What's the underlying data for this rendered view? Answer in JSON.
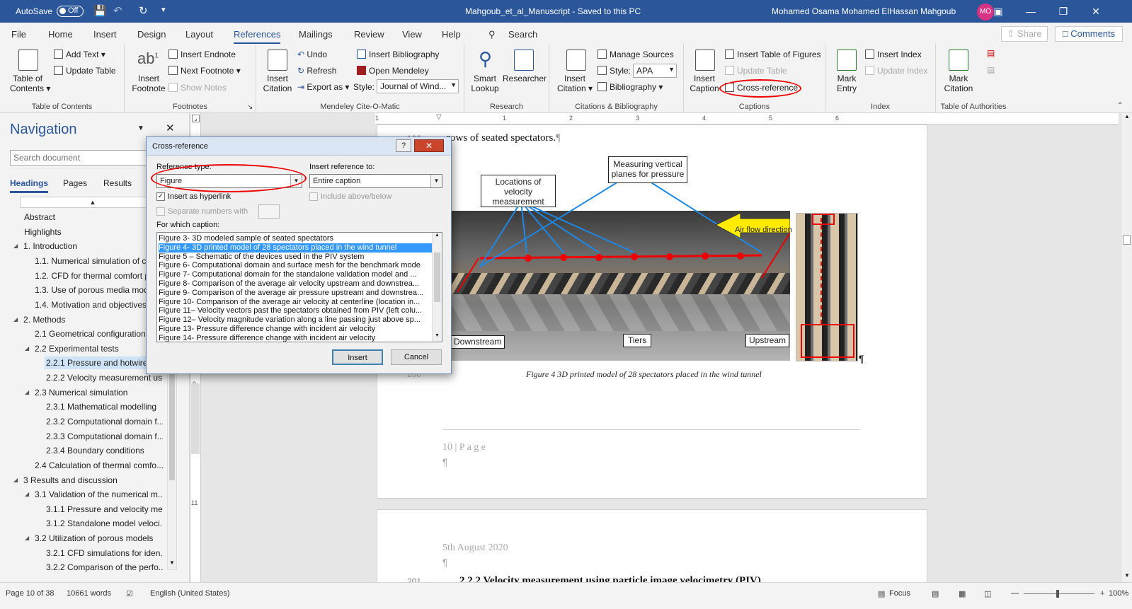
{
  "titlebar": {
    "autosave_label": "AutoSave",
    "autosave_state": "Off",
    "doc_title": "Mahgoub_et_al_Manuscript  -  Saved to this PC",
    "user_name": "Mohamed Osama Mohamed ElHassan Mahgoub",
    "user_initials": "MO"
  },
  "tabs": [
    {
      "label": "File"
    },
    {
      "label": "Home"
    },
    {
      "label": "Insert"
    },
    {
      "label": "Design"
    },
    {
      "label": "Layout"
    },
    {
      "label": "References"
    },
    {
      "label": "Mailings"
    },
    {
      "label": "Review"
    },
    {
      "label": "View"
    },
    {
      "label": "Help"
    }
  ],
  "search_label": "Search",
  "share_label": "Share",
  "comments_label": "Comments",
  "ribbon": {
    "toc": {
      "label": "Table of Contents",
      "btn1": "Table of",
      "btn2": "Contents",
      "add_text": "Add Text",
      "update_table": "Update Table"
    },
    "footnotes": {
      "label": "Footnotes",
      "insert1": "Insert",
      "insert2": "Footnote",
      "insert_endnote": "Insert Endnote",
      "next_footnote": "Next Footnote",
      "show_notes": "Show Notes"
    },
    "mendeley": {
      "label": "Mendeley Cite-O-Matic",
      "insert1": "Insert",
      "insert2": "Citation",
      "undo": "Undo",
      "refresh": "Refresh",
      "export_as": "Export as",
      "insert_bibliography": "Insert Bibliography",
      "open_mendeley": "Open Mendeley",
      "style_label": "Style:",
      "style_value": "Journal of Wind..."
    },
    "research": {
      "label": "Research",
      "smart1": "Smart",
      "smart2": "Lookup",
      "researcher": "Researcher"
    },
    "citations": {
      "label": "Citations & Bibliography",
      "insert1": "Insert",
      "insert2": "Citation",
      "manage_sources": "Manage Sources",
      "style_label": "Style:",
      "style_value": "APA",
      "bibliography": "Bibliography"
    },
    "captions": {
      "label": "Captions",
      "insert1": "Insert",
      "insert2": "Caption",
      "insert_tof": "Insert Table of Figures",
      "update_table": "Update Table",
      "cross_reference": "Cross-reference"
    },
    "index": {
      "label": "Index",
      "mark1": "Mark",
      "mark2": "Entry",
      "insert_index": "Insert Index",
      "update_index": "Update Index"
    },
    "toa": {
      "label": "Table of Authorities",
      "mark1": "Mark",
      "mark2": "Citation"
    }
  },
  "nav": {
    "title": "Navigation",
    "search_placeholder": "Search document",
    "tabs": [
      "Headings",
      "Pages",
      "Results"
    ],
    "items": [
      {
        "text": "Abstract"
      },
      {
        "text": "Highlights"
      },
      {
        "text": "1. Introduction"
      },
      {
        "text": "1.1. Numerical simulation of c..."
      },
      {
        "text": "1.2. CFD for thermal comfort p..."
      },
      {
        "text": "1.3. Use of porous media mod..."
      },
      {
        "text": "1.4. Motivation and objectives"
      },
      {
        "text": "2. Methods"
      },
      {
        "text": "2.1 Geometrical configuration"
      },
      {
        "text": "2.2 Experimental tests"
      },
      {
        "text": "2.2.1 Pressure and hotwire v..."
      },
      {
        "text": "2.2.2 Velocity measurement us..."
      },
      {
        "text": "2.3 Numerical simulation"
      },
      {
        "text": "2.3.1 Mathematical modelling"
      },
      {
        "text": "2.3.2 Computational domain f..."
      },
      {
        "text": "2.3.3 Computational domain f..."
      },
      {
        "text": "2.3.4 Boundary conditions"
      },
      {
        "text": "2.4 Calculation of thermal comfo..."
      },
      {
        "text": "3 Results and discussion"
      },
      {
        "text": "3.1 Validation of the numerical m..."
      },
      {
        "text": "3.1.1 Pressure and velocity me..."
      },
      {
        "text": "3.1.2 Standalone model veloci..."
      },
      {
        "text": "3.2 Utilization of porous models"
      },
      {
        "text": "3.2.1  CFD simulations for iden..."
      },
      {
        "text": "3.2.2 Comparison of the perfo..."
      }
    ]
  },
  "document": {
    "top_line": "rows of seated spectators.",
    "line_no_top": "199",
    "line_no_mid": "200",
    "line_no_bottom": "201",
    "label_velocity": "Locations of velocity measurement",
    "label_pressure": "Measuring vertical planes for pressure",
    "label_airflow": "Air flow direction",
    "label_downstream": "Downstream",
    "label_tiers": "Tiers",
    "label_upstream": "Upstream",
    "figure_caption": "Figure 4  3D printed model of 28 spectators placed in the wind tunnel",
    "footer_page": "10 | P a g e",
    "date": "5th August 2020",
    "heading_partial": "2.2.2  Velocity measurement using particle image velocimetry (PIV)"
  },
  "dialog": {
    "title": "Cross-reference",
    "reference_type_label": "Reference type:",
    "reference_type_value": "Figure",
    "insert_reference_label": "Insert reference to:",
    "insert_reference_value": "Entire caption",
    "insert_hyperlink": "Insert as hyperlink",
    "include_above_below": "Include above/below",
    "separate_numbers": "Separate numbers with",
    "for_which_caption": "For which caption:",
    "captions": [
      "Figure 3- 3D modeled sample of seated spectators",
      "Figure 4- 3D printed model of 28 spectators placed in the wind tunnel",
      "Figure 5 – Schematic of the devices used in the PIV system",
      "Figure 6- Computational domain and surface mesh for the benchmark mode",
      "Figure 7- Computational domain for the standalone validation model and ...",
      "Figure 8- Comparison of the average air velocity upstream and downstrea...",
      "Figure 9- Comparison of the average air pressure upstream and downstrea...",
      "Figure 10- Comparison of the average air velocity at centerline (location in...",
      "Figure 11– Velocity vectors past the spectators obtained from PIV (left colu...",
      "Figure 12– Velocity magnitude variation along a line passing just above sp...",
      "Figure 13- Pressure difference change with incident air velocity",
      "Figure 14- Pressure difference change with incident air velocity"
    ],
    "selected_index": 1,
    "insert_btn": "Insert",
    "cancel_btn": "Cancel"
  },
  "status": {
    "page": "Page 10 of 38",
    "words": "10661 words",
    "language": "English (United States)",
    "focus": "Focus",
    "zoom": "100%"
  },
  "colors": {
    "brand": "#2b579a",
    "annotation_red": "#e00000",
    "selection_blue": "#3399ff"
  }
}
